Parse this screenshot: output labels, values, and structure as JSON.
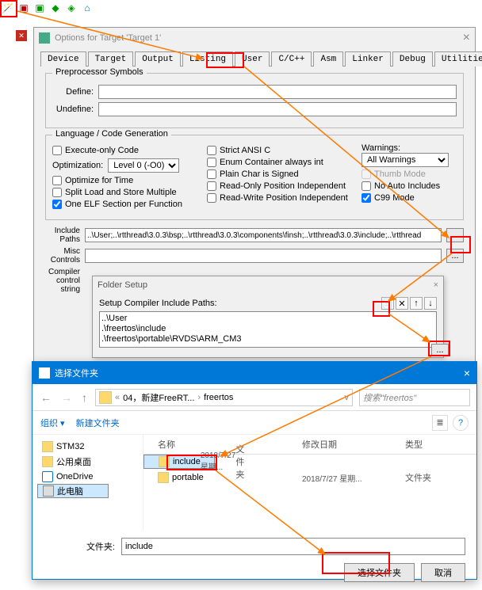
{
  "toolbar_icons": [
    "wand",
    "red-green",
    "two-green",
    "diamond",
    "two-diamond",
    "home"
  ],
  "options": {
    "title": "Options for Target 'Target 1'",
    "tabs": [
      "Device",
      "Target",
      "Output",
      "Listing",
      "User",
      "C/C++",
      "Asm",
      "Linker",
      "Debug",
      "Utilities"
    ],
    "active_tab": "C/C++",
    "preprocessor": {
      "title": "Preprocessor Symbols",
      "define_lbl": "Define:",
      "undefine_lbl": "Undefine:",
      "define": "",
      "undefine": ""
    },
    "lang": {
      "title": "Language / Code Generation",
      "exec_only": "Execute-only Code",
      "opt_lbl": "Optimization:",
      "opt_val": "Level 0 (-O0)",
      "opt_time": "Optimize for Time",
      "split": "Split Load and Store Multiple",
      "one_elf": "One ELF Section per Function",
      "strict": "Strict ANSI C",
      "enum": "Enum Container always int",
      "plain": "Plain Char is Signed",
      "ro_pos": "Read-Only Position Independent",
      "rw_pos": "Read-Write Position Independent",
      "warn_lbl": "Warnings:",
      "warn_val": "All Warnings",
      "thumb": "Thumb Mode",
      "noauto": "No Auto Includes",
      "c99": "C99 Mode"
    },
    "include_lbl": "Include Paths",
    "include_val": "..\\User;..\\rtthread\\3.0.3\\bsp;..\\rtthread\\3.0.3\\components\\finsh;..\\rtthread\\3.0.3\\include;..\\rtthread",
    "misc_lbl": "Misc Controls",
    "misc_val": "",
    "compiler_lbl": "Compiler control string"
  },
  "folder_setup": {
    "title": "Folder Setup",
    "lbl": "Setup Compiler Include Paths:",
    "items": [
      "..\\User",
      ".\\freertos\\include",
      ".\\freertos\\portable\\RVDS\\ARM_CM3"
    ],
    "dots": "..."
  },
  "picker": {
    "title": "选择文件夹",
    "crumb": [
      "04，新建FreeRT...",
      "freertos"
    ],
    "search_ph": "搜索\"freertos\"",
    "org": "组织",
    "newf": "新建文件夹",
    "tree": [
      {
        "n": "STM32",
        "i": "f"
      },
      {
        "n": "公用桌面",
        "i": "f"
      },
      {
        "n": "OneDrive",
        "i": "od"
      },
      {
        "n": "此电脑",
        "i": "pc",
        "sel": true
      }
    ],
    "cols": {
      "name": "名称",
      "date": "修改日期",
      "type": "类型"
    },
    "rows": [
      {
        "name": "include",
        "date": "2018/7/27 星期...",
        "type": "文件夹",
        "sel": true
      },
      {
        "name": "portable",
        "date": "2018/7/27 星期...",
        "type": "文件夹"
      }
    ],
    "fn_lbl": "文件夹:",
    "fn_val": "include",
    "ok": "选择文件夹",
    "cancel": "取消"
  }
}
